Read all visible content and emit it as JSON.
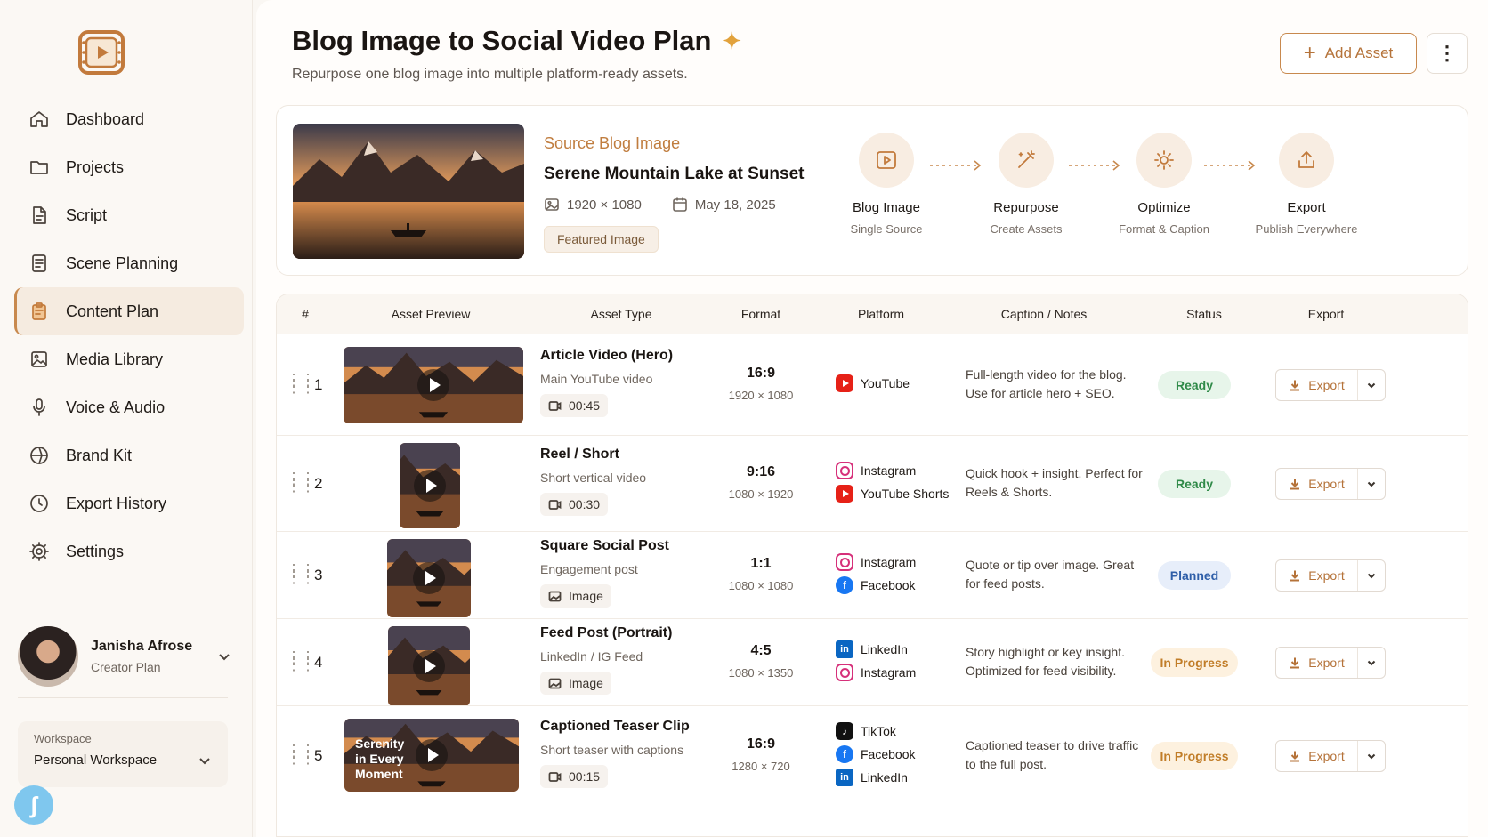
{
  "sidebar": {
    "items": [
      {
        "label": "Dashboard",
        "icon": "home-icon"
      },
      {
        "label": "Projects",
        "icon": "folder-icon"
      },
      {
        "label": "Script",
        "icon": "document-icon"
      },
      {
        "label": "Scene Planning",
        "icon": "list-document-icon"
      },
      {
        "label": "Content Plan",
        "icon": "clipboard-icon",
        "active": true
      },
      {
        "label": "Media Library",
        "icon": "image-stack-icon"
      },
      {
        "label": "Voice & Audio",
        "icon": "microphone-icon"
      },
      {
        "label": "Brand Kit",
        "icon": "palette-icon"
      },
      {
        "label": "Export History",
        "icon": "clock-icon"
      },
      {
        "label": "Settings",
        "icon": "gear-icon"
      }
    ],
    "user": {
      "name": "Janisha Afrose",
      "plan": "Creator Plan"
    },
    "workspace": {
      "label": "Workspace",
      "value": "Personal Workspace"
    }
  },
  "header": {
    "title": "Blog Image to Social Video Plan",
    "subtitle": "Repurpose one blog image into multiple platform-ready assets.",
    "add_label": "Add Asset"
  },
  "source": {
    "label": "Source Blog Image",
    "title": "Serene Mountain Lake at Sunset",
    "dimensions": "1920 × 1080",
    "date": "May 18, 2025",
    "tag": "Featured Image"
  },
  "workflow": [
    {
      "title": "Blog Image",
      "sub": "Single Source",
      "icon": "video-frame-icon"
    },
    {
      "title": "Repurpose",
      "sub": "Create Assets",
      "icon": "magic-wand-icon"
    },
    {
      "title": "Optimize",
      "sub": "Format & Caption",
      "icon": "gear-icon"
    },
    {
      "title": "Export",
      "sub": "Publish Everywhere",
      "icon": "share-icon"
    }
  ],
  "table": {
    "headers": [
      "#",
      "Asset Preview",
      "Asset Type",
      "Format",
      "Platform",
      "Caption / Notes",
      "Status",
      "Export"
    ],
    "export_label": "Export",
    "rows": [
      {
        "num": "1",
        "title": "Article Video (Hero)",
        "sub": "Main YouTube video",
        "pill": "00:45",
        "pill_icon": "video-icon",
        "ratio": "16:9",
        "dim": "1920 × 1080",
        "platforms": [
          "YouTube"
        ],
        "caption": "Full-length video for the blog. Use for article hero + SEO.",
        "status": "Ready",
        "status_kind": "ready"
      },
      {
        "num": "2",
        "title": "Reel / Short",
        "sub": "Short vertical video",
        "pill": "00:30",
        "pill_icon": "video-icon",
        "ratio": "9:16",
        "dim": "1080 × 1920",
        "platforms": [
          "Instagram",
          "YouTube Shorts"
        ],
        "caption": "Quick hook + insight. Perfect for Reels & Shorts.",
        "status": "Ready",
        "status_kind": "ready"
      },
      {
        "num": "3",
        "title": "Square Social Post",
        "sub": "Engagement post",
        "pill": "Image",
        "pill_icon": "image-icon",
        "ratio": "1:1",
        "dim": "1080 × 1080",
        "platforms": [
          "Instagram",
          "Facebook"
        ],
        "caption": "Quote or tip over image. Great for feed posts.",
        "status": "Planned",
        "status_kind": "planned"
      },
      {
        "num": "4",
        "title": "Feed Post (Portrait)",
        "sub": "LinkedIn / IG Feed",
        "pill": "Image",
        "pill_icon": "image-icon",
        "ratio": "4:5",
        "dim": "1080 × 1350",
        "platforms": [
          "LinkedIn",
          "Instagram"
        ],
        "caption": "Story highlight or key insight. Optimized for feed visibility.",
        "status": "In Progress",
        "status_kind": "inprog"
      },
      {
        "num": "5",
        "title": "Captioned Teaser Clip",
        "sub": "Short teaser with captions",
        "pill": "00:15",
        "pill_icon": "video-icon",
        "ratio": "16:9",
        "dim": "1280 × 720",
        "platforms": [
          "TikTok",
          "Facebook",
          "LinkedIn"
        ],
        "caption": "Captioned teaser to drive traffic to the full post.",
        "status": "In Progress",
        "status_kind": "inprog",
        "overlay": "Serenity in Every Moment"
      }
    ]
  },
  "colors": {
    "accent": "#c8894e",
    "ready": "#2f8a48",
    "planned": "#2e5ea8",
    "in_progress": "#c17d28"
  }
}
